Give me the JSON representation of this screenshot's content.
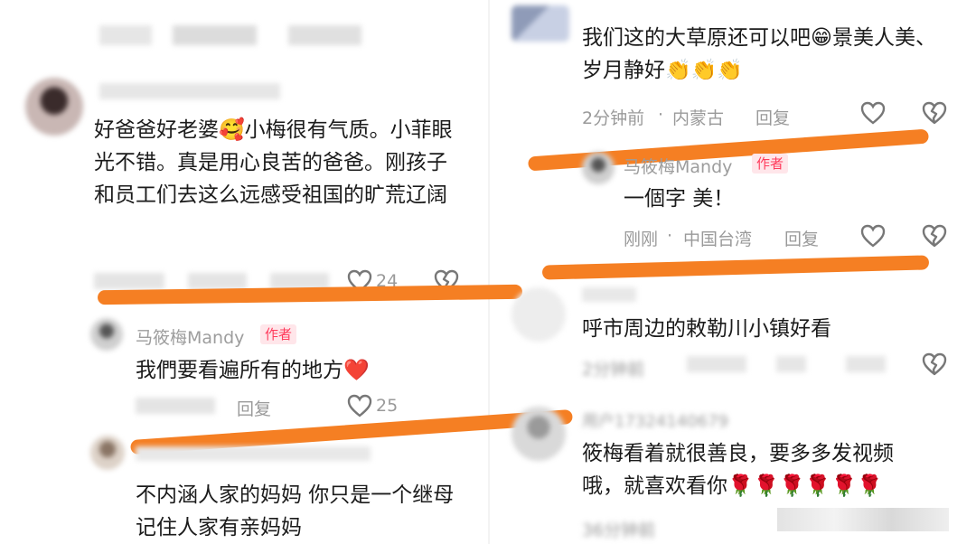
{
  "left": {
    "c1": {
      "text": "好爸爸好老婆🥰小梅很有气质。小菲眼光不错。真是用心良苦的爸爸。刚孩子和员工们去这么远感受祖国的旷荒辽阔",
      "like_count": "24"
    },
    "reply1": {
      "name": "马筱梅Mandy",
      "badge": "作者",
      "text": "我們要看遍所有的地方❤️",
      "reply_label": "回复",
      "like_count": "25"
    },
    "c2": {
      "text": "不内涵人家的妈妈 你只是一个继母 记住人家有亲妈妈"
    }
  },
  "right": {
    "c1": {
      "text": "我们这的大草原还可以吧😁景美人美、岁月静好👏👏👏",
      "time": "2分钟前",
      "location": "内蒙古",
      "reply_label": "回复"
    },
    "reply1": {
      "name": "马筱梅Mandy",
      "badge": "作者",
      "text": "一個字 美！",
      "time": "刚刚",
      "location": "中国台湾",
      "reply_label": "回复"
    },
    "c2": {
      "text": "呼市周边的敕勒川小镇好看",
      "time": "2分钟前"
    },
    "c3": {
      "user": "用户1732414067​9",
      "text": "筱梅看着就很善良，要多多发视频哦，就喜欢看你🌹🌹🌹🌹🌹🌹",
      "time": "36分钟前"
    }
  },
  "colors": {
    "annotation_stroke": "#f57f23",
    "badge": "#ff3b5c",
    "meta_text": "#9a9a9a"
  },
  "icons": [
    "heart-icon",
    "broken-heart-icon"
  ]
}
